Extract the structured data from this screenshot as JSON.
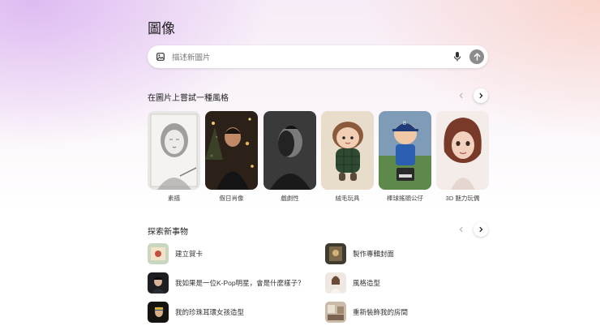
{
  "page": {
    "title": "圖像"
  },
  "search": {
    "placeholder": "描述新圖片"
  },
  "styles": {
    "heading": "在圖片上嘗試一種風格",
    "items": [
      {
        "label": "素描"
      },
      {
        "label": "假日肖像"
      },
      {
        "label": "戲劇性"
      },
      {
        "label": "絨毛玩具"
      },
      {
        "label": "棒球搖頭公仔"
      },
      {
        "label": "3D 魅力玩偶"
      }
    ]
  },
  "explore": {
    "heading": "探索新事物",
    "items": [
      {
        "label": "建立賀卡"
      },
      {
        "label": "製作專輯封面"
      },
      {
        "label": "我如果是一位K-Pop明星，會是什麼樣子？"
      },
      {
        "label": "風格造型"
      },
      {
        "label": "我的珍珠耳環女孩造型"
      },
      {
        "label": "重新裝飾我的房間"
      }
    ]
  },
  "colors": {
    "send_button": "#8c8c8c",
    "bg_purple": "#d6aaf0",
    "bg_peach": "#facdbe"
  }
}
